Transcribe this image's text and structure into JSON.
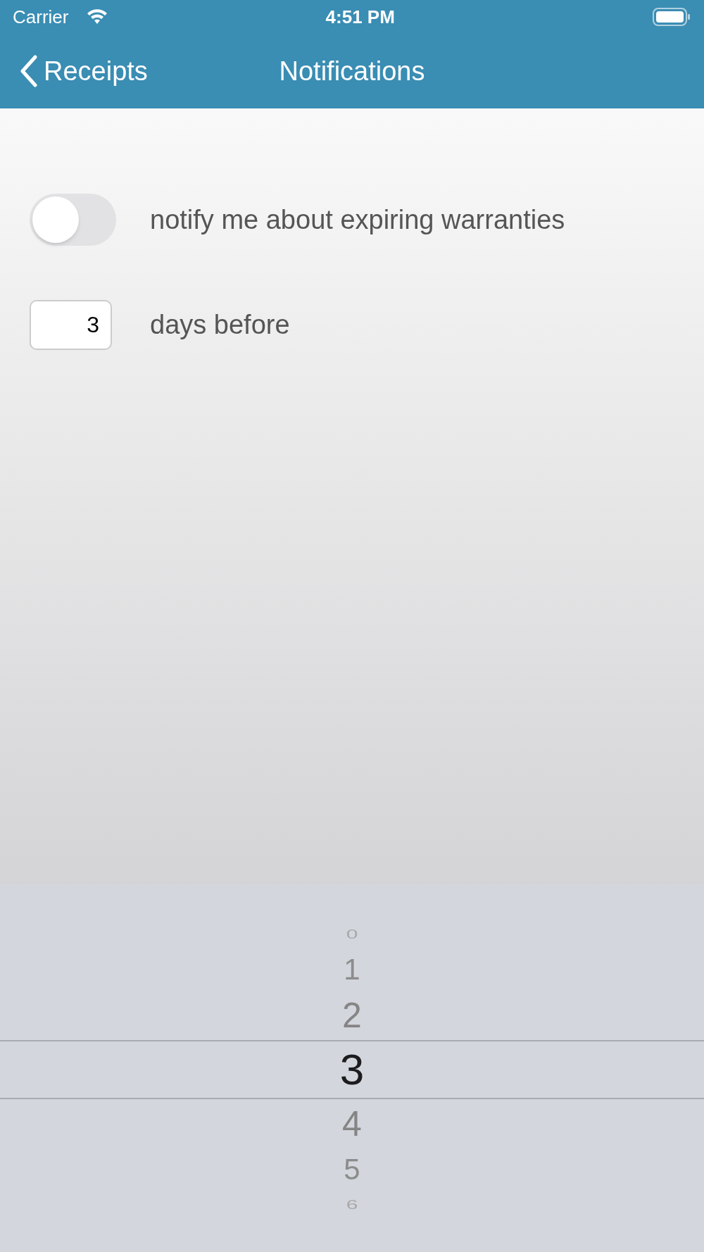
{
  "status_bar": {
    "carrier": "Carrier",
    "time": "4:51 PM"
  },
  "nav_bar": {
    "back_label": "Receipts",
    "title": "Notifications"
  },
  "settings": {
    "toggle": {
      "label": "notify me about expiring warranties",
      "on": false
    },
    "days": {
      "value": "3",
      "label": "days before"
    }
  },
  "picker": {
    "items": [
      {
        "label": "0",
        "selected": false
      },
      {
        "label": "1",
        "selected": false
      },
      {
        "label": "2",
        "selected": false
      },
      {
        "label": "3",
        "selected": true
      },
      {
        "label": "4",
        "selected": false
      },
      {
        "label": "5",
        "selected": false
      },
      {
        "label": "6",
        "selected": false
      }
    ]
  }
}
